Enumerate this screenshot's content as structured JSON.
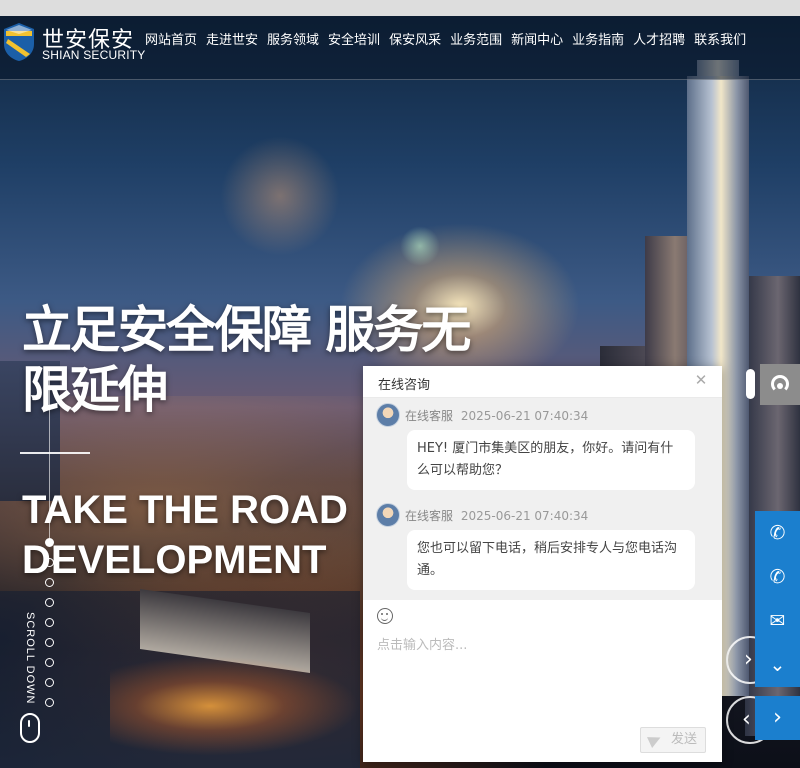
{
  "brand": {
    "name_cn": "世安保安",
    "name_en": "SHIAN SECURITY"
  },
  "nav": {
    "items": [
      {
        "label": "网站首页"
      },
      {
        "label": "走进世安"
      },
      {
        "label": "服务领域"
      },
      {
        "label": "安全培训"
      },
      {
        "label": "保安风采"
      },
      {
        "label": "业务范围"
      },
      {
        "label": "新闻中心"
      },
      {
        "label": "业务指南"
      },
      {
        "label": "人才招聘"
      },
      {
        "label": "联系我们"
      }
    ]
  },
  "hero": {
    "headline": "立足安全保障 服务无限延伸",
    "subheadline": "TAKE THE ROAD DEVELOPMENT",
    "scroll_label": "SCROLL DOWN"
  },
  "chat": {
    "title": "在线咨询",
    "messages": [
      {
        "sender": "在线客服",
        "time": "2025-06-21 07:40:34",
        "text": "HEY! 厦门市集美区的朋友，你好。请问有什么可以帮助您？"
      },
      {
        "sender": "在线客服",
        "time": "2025-06-21 07:40:34",
        "text": "您也可以留下电话，稍后安排专人与您电话沟通。"
      }
    ],
    "input_placeholder": "点击输入内容...",
    "send_label": "发送"
  },
  "icons": {
    "close": "close-icon",
    "emoji": "emoji-icon",
    "send": "paper-plane-icon",
    "headset": "headset-icon",
    "phone": "phone-icon",
    "mail": "mail-icon",
    "chevron_down": "chevron-down-icon",
    "chevron_right": "chevron-right-icon",
    "mouse": "mouse-icon"
  },
  "colors": {
    "accent_blue": "#1b7fce",
    "headset_gray": "#8c8c8c",
    "chat_bg": "#f0f0f0"
  }
}
